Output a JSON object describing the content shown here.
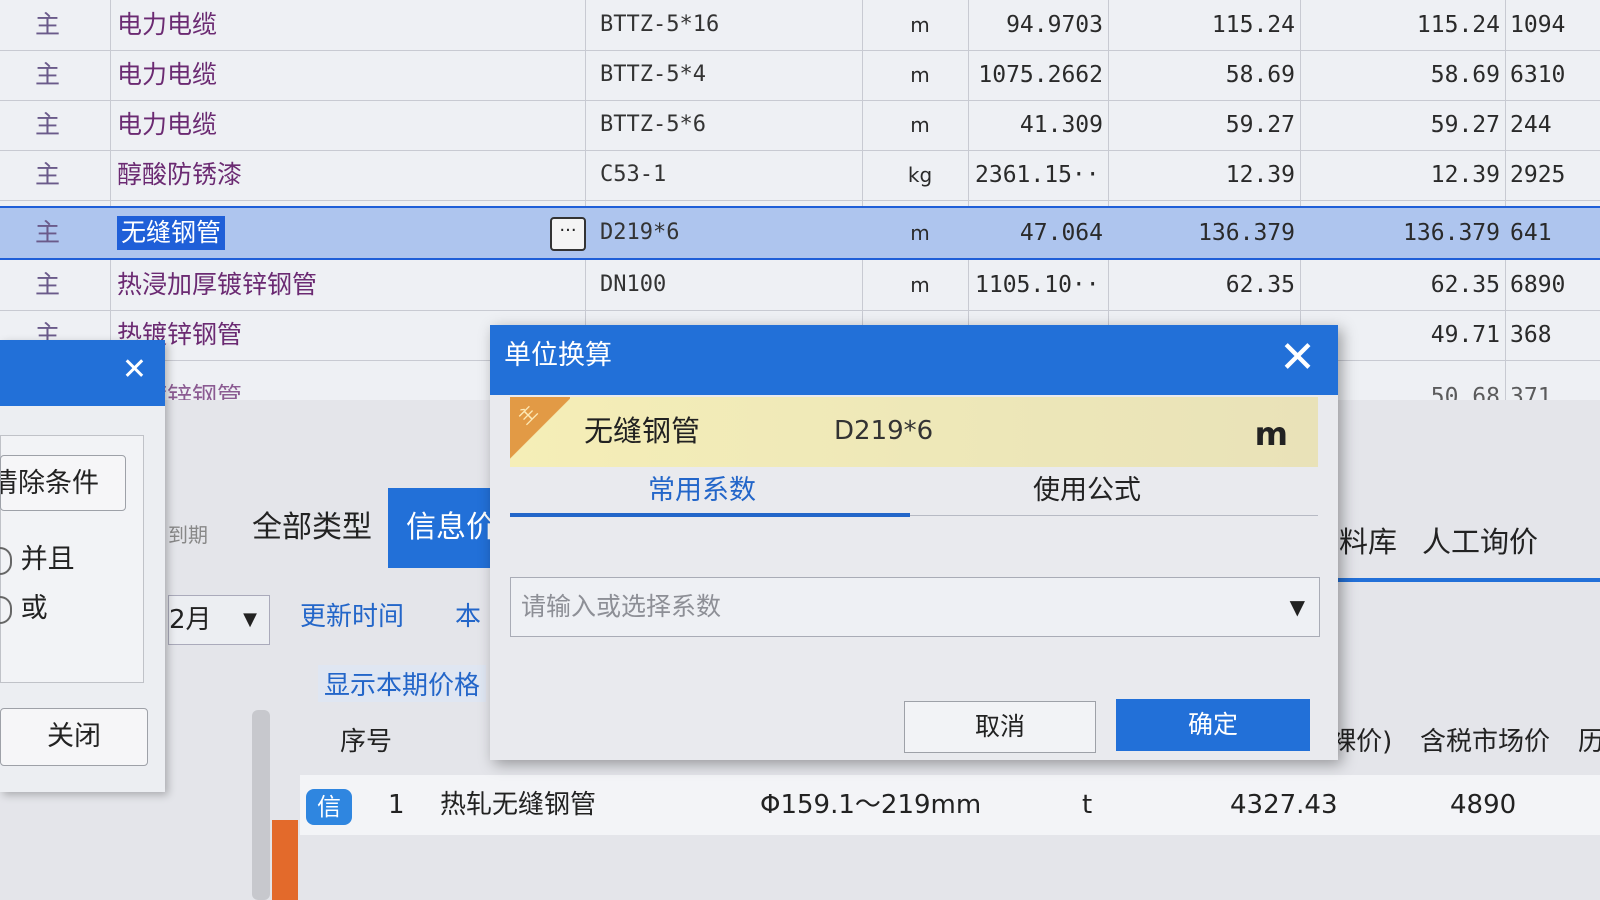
{
  "material_table": {
    "rows": [
      {
        "type": "主",
        "name": "电力电缆",
        "spec": "BTTZ-5*16",
        "unit": "m",
        "qty": "94.9703",
        "price1": "115.24",
        "price2": "115.24",
        "total": "1094"
      },
      {
        "type": "主",
        "name": "电力电缆",
        "spec": "BTTZ-5*4",
        "unit": "m",
        "qty": "1075.2662",
        "price1": "58.69",
        "price2": "58.69",
        "total": "6310"
      },
      {
        "type": "主",
        "name": "电力电缆",
        "spec": "BTTZ-5*6",
        "unit": "m",
        "qty": "41.309",
        "price1": "59.27",
        "price2": "59.27",
        "total": "244"
      },
      {
        "type": "主",
        "name": "醇酸防锈漆",
        "spec": "C53-1",
        "unit": "kg",
        "qty": "2361.15···",
        "price1": "12.39",
        "price2": "12.39",
        "total": "2925"
      },
      {
        "type": "主",
        "name": "无缝钢管",
        "spec": "D219*6",
        "unit": "m",
        "qty": "47.064",
        "price1": "136.379",
        "price2": "136.379",
        "total": "641"
      },
      {
        "type": "主",
        "name": "热浸加厚镀锌钢管",
        "spec": "DN100",
        "unit": "m",
        "qty": "1105.10···",
        "price1": "62.35",
        "price2": "62.35",
        "total": "6890"
      },
      {
        "type": "主",
        "name": "热镀锌钢管",
        "spec": "",
        "unit": "",
        "qty": "",
        "price1": "",
        "price2": "49.71",
        "total": "368"
      },
      {
        "type": "",
        "name": "热镀锌钢管",
        "spec": "",
        "unit": "",
        "qty": "",
        "price1": "",
        "price2": "50.68",
        "total": "371"
      }
    ],
    "ellipsis": "···"
  },
  "lower_panel": {
    "tab_period": "到期",
    "tab_all_types": "全部类型",
    "tab_info": "信息价",
    "tab_material_lib": "材料库",
    "tab_labor": "人工询价",
    "month": "2月",
    "update_time": "更新时间",
    "current": "本",
    "show_current_price": "显示本期价格",
    "col_seq": "序号",
    "col_bare_price": "(裸价)",
    "col_tax_market_price": "含税市场价",
    "col_more": "历",
    "row": {
      "badge": "信",
      "seq": "1",
      "name": "热轧无缝钢管",
      "spec": "Φ159.1～219mm",
      "unit": "t",
      "price": "4327.43",
      "tax_price": "4890"
    }
  },
  "left_dialog": {
    "close": "✕",
    "clear_conditions": "清除条件",
    "and": "并且",
    "or": "或",
    "close_button": "关闭"
  },
  "unit_conversion_dialog": {
    "title": "单位换算",
    "close": "✕",
    "tag": "主",
    "material_name": "无缝钢管",
    "material_spec": "D219*6",
    "material_unit": "m",
    "tab_common": "常用系数",
    "tab_formula": "使用公式",
    "coef_placeholder": "请输入或选择系数",
    "cancel": "取消",
    "confirm": "确定"
  },
  "colors": {
    "accent": "#2270d8",
    "selection": "#aec5ee",
    "banner": "#f5eeb7",
    "tag": "#e29a45"
  }
}
